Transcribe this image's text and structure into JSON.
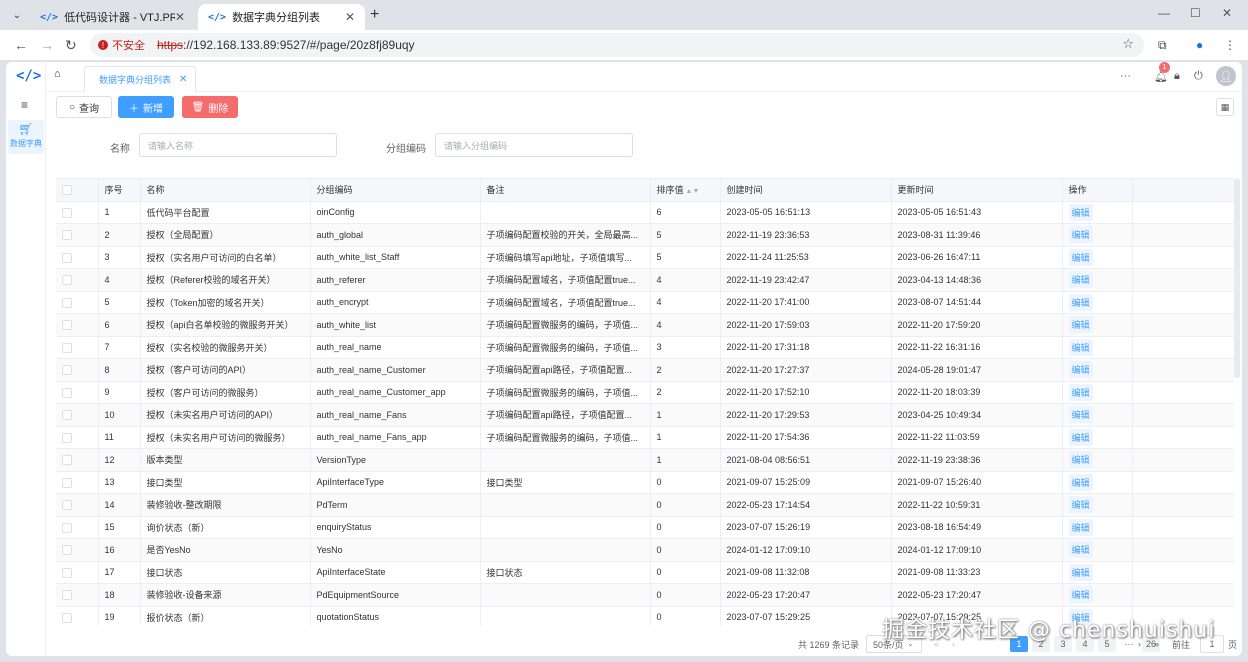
{
  "browser": {
    "tabs": [
      {
        "label": "低代码设计器 - VTJ.PRO",
        "active": false
      },
      {
        "label": "数据字典分组列表",
        "active": true
      }
    ],
    "insecure_label": "不安全",
    "url_scheme": "https",
    "url_rest": "://192.168.133.89:9527/#/page/20z8fj89uqy"
  },
  "sidebar": {
    "items": [
      {
        "label": "数据字典",
        "icon": "cart-icon"
      }
    ]
  },
  "topbar": {
    "page_tab": "数据字典分组列表",
    "notification_count": "1"
  },
  "toolbar": {
    "query_label": "查询",
    "add_label": "新增",
    "delete_label": "删除"
  },
  "filters": {
    "name_label": "名称",
    "name_placeholder": "请输入名称",
    "code_label": "分组编码",
    "code_placeholder": "请输入分组编码"
  },
  "table": {
    "columns": [
      "序号",
      "名称",
      "分组编码",
      "备注",
      "排序值",
      "创建时间",
      "更新时间",
      "操作"
    ],
    "edit_label": "编辑",
    "rows": [
      [
        "1",
        "低代码平台配置",
        "oinConfig",
        "",
        "6",
        "2023-05-05 16:51:13",
        "2023-05-05 16:51:43"
      ],
      [
        "2",
        "授权（全局配置）",
        "auth_global",
        "子项编码配置校验的开关，全局最高...",
        "5",
        "2022-11-19 23:36:53",
        "2023-08-31 11:39:46"
      ],
      [
        "3",
        "授权（实名用户可访问的白名单）",
        "auth_white_list_Staff",
        "子项编码填写api地址，子项值填写...",
        "5",
        "2022-11-24 11:25:53",
        "2023-06-26 16:47:11"
      ],
      [
        "4",
        "授权（Referer校验的域名开关）",
        "auth_referer",
        "子项编码配置域名，子项值配置true...",
        "4",
        "2022-11-19 23:42:47",
        "2023-04-13 14:48:36"
      ],
      [
        "5",
        "授权（Token加密的域名开关）",
        "auth_encrypt",
        "子项编码配置域名，子项值配置true...",
        "4",
        "2022-11-20 17:41:00",
        "2023-08-07 14:51:44"
      ],
      [
        "6",
        "授权（api白名单校验的微服务开关）",
        "auth_white_list",
        "子项编码配置微服务的编码，子项值...",
        "4",
        "2022-11-20 17:59:03",
        "2022-11-20 17:59:20"
      ],
      [
        "7",
        "授权（实名校验的微服务开关）",
        "auth_real_name",
        "子项编码配置微服务的编码，子项值...",
        "3",
        "2022-11-20 17:31:18",
        "2022-11-22 16:31:16"
      ],
      [
        "8",
        "授权（客户可访问的API）",
        "auth_real_name_Customer",
        "子项编码配置api路径，子项值配置...",
        "2",
        "2022-11-20 17:27:37",
        "2024-05-28 19:01:47"
      ],
      [
        "9",
        "授权（客户可访问的微服务）",
        "auth_real_name_Customer_app",
        "子项编码配置微服务的编码，子项值...",
        "2",
        "2022-11-20 17:52:10",
        "2022-11-20 18:03:39"
      ],
      [
        "10",
        "授权（未实名用户可访问的API）",
        "auth_real_name_Fans",
        "子项编码配置api路径，子项值配置...",
        "1",
        "2022-11-20 17:29:53",
        "2023-04-25 10:49:34"
      ],
      [
        "11",
        "授权（未实名用户可访问的微服务）",
        "auth_real_name_Fans_app",
        "子项编码配置微服务的编码，子项值...",
        "1",
        "2022-11-20 17:54:36",
        "2022-11-22 11:03:59"
      ],
      [
        "12",
        "版本类型",
        "VersionType",
        "",
        "1",
        "2021-08-04 08:56:51",
        "2022-11-19 23:38:36"
      ],
      [
        "13",
        "接口类型",
        "ApiInterfaceType",
        "接口类型",
        "0",
        "2021-09-07 15:25:09",
        "2021-09-07 15:26:40"
      ],
      [
        "14",
        "装修验收-整改期限",
        "PdTerm",
        "",
        "0",
        "2022-05-23 17:14:54",
        "2022-11-22 10:59:31"
      ],
      [
        "15",
        "询价状态（新）",
        "enquiryStatus",
        "",
        "0",
        "2023-07-07 15:26:19",
        "2023-08-18 16:54:49"
      ],
      [
        "16",
        "是否YesNo",
        "YesNo",
        "",
        "0",
        "2024-01-12 17:09:10",
        "2024-01-12 17:09:10"
      ],
      [
        "17",
        "接口状态",
        "ApiInterfaceState",
        "接口状态",
        "0",
        "2021-09-08 11:32:08",
        "2021-09-08 11:33:23"
      ],
      [
        "18",
        "装修验收-设备来源",
        "PdEquipmentSource",
        "",
        "0",
        "2022-05-23 17:20:47",
        "2022-05-23 17:20:47"
      ],
      [
        "19",
        "报价状态（新）",
        "quotationStatus",
        "",
        "0",
        "2023-07-07 15:29:25",
        "2023-07-07 15:29:25"
      ]
    ]
  },
  "pagination": {
    "total": "共 1269 条记录",
    "page_size": "50条/页",
    "pages": [
      "1",
      "2",
      "3",
      "4",
      "5",
      "···",
      "26"
    ],
    "current": "1",
    "goto_label": "前往",
    "goto_value": "1",
    "page_suffix": "页"
  },
  "watermark": "掘金技术社区 @ chenshuishui"
}
